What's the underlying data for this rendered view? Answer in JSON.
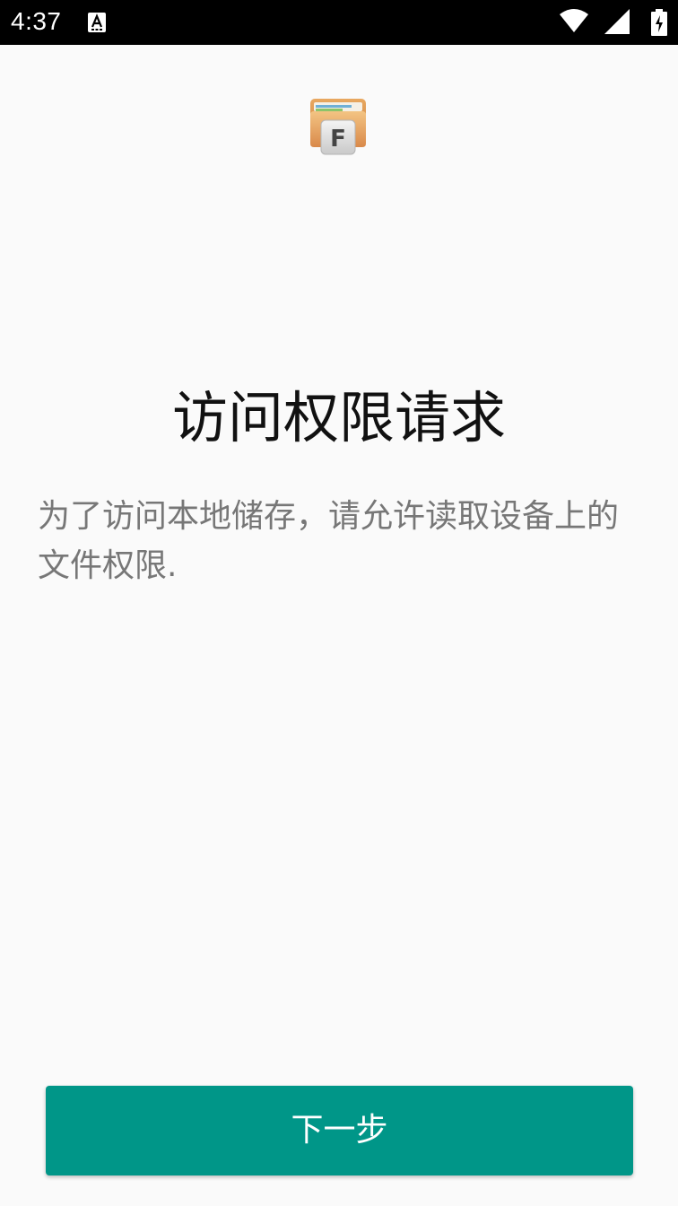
{
  "status_bar": {
    "time": "4:37",
    "icons": [
      "notification-a-icon",
      "wifi-icon",
      "cellular-icon",
      "battery-charging-icon"
    ]
  },
  "app": {
    "logo_letter": "F",
    "logo_icon": "file-manager-folder-icon"
  },
  "permission": {
    "title": "访问权限请求",
    "description": "为了访问本地储存，请允许读取设备上的文件权限."
  },
  "actions": {
    "next_label": "下一步"
  },
  "colors": {
    "accent": "#009688",
    "background": "#fafafa",
    "status_bar": "#000000",
    "title_text": "#111111",
    "description_text": "#777777"
  }
}
